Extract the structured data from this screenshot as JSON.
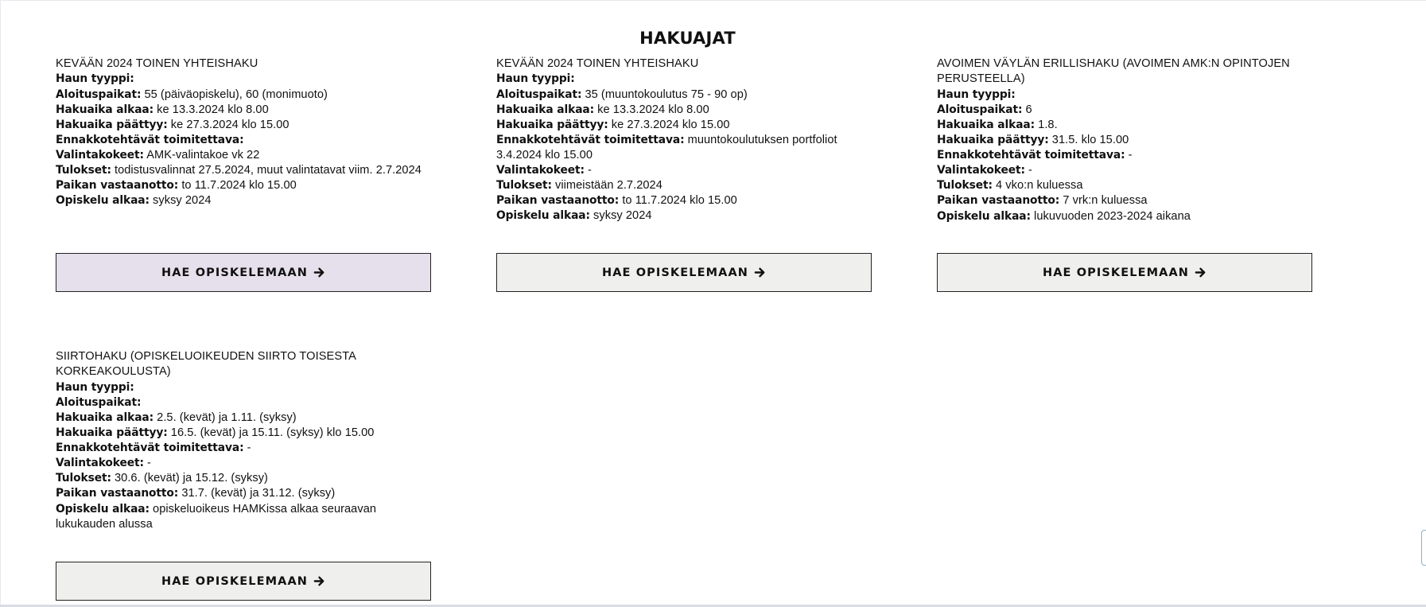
{
  "page_title": "HAKUAJAT",
  "cards": [
    {
      "title": "KEVÄÄN 2024 TOINEN YHTEISHAKU",
      "fields": {
        "tyyppi_label": "Haun tyyppi:",
        "tyyppi_value": "",
        "paikat_label": "Aloituspaikat:",
        "paikat_value": "55 (päiväopiskelu), 60 (monimuoto)",
        "alkaa_label": "Hakuaika alkaa:",
        "alkaa_value": "ke 13.3.2024 klo 8.00",
        "paattyy_label": "Hakuaika päättyy:",
        "paattyy_value": "ke 27.3.2024 klo 15.00",
        "ennakko_label": "Ennakkotehtävät toimitettava:",
        "ennakko_value": "",
        "valinta_label": "Valintakokeet:",
        "valinta_value": "AMK-valintakoe vk 22",
        "tulokset_label": "Tulokset:",
        "tulokset_value": "todistusvalinnat 27.5.2024, muut valintatavat viim. 2.7.2024",
        "vastaanotto_label": "Paikan vastaanotto:",
        "vastaanotto_value": "to 11.7.2024 klo 15.00",
        "opiskelu_label": "Opiskelu alkaa:",
        "opiskelu_value": "syksy 2024"
      },
      "button_label": "HAE OPISKELEMAAN"
    },
    {
      "title": "KEVÄÄN 2024 TOINEN YHTEISHAKU",
      "fields": {
        "tyyppi_label": "Haun tyyppi:",
        "tyyppi_value": "",
        "paikat_label": "Aloituspaikat:",
        "paikat_value": "35 (muuntokoulutus 75 - 90 op)",
        "alkaa_label": "Hakuaika alkaa:",
        "alkaa_value": "ke 13.3.2024 klo 8.00",
        "paattyy_label": "Hakuaika päättyy:",
        "paattyy_value": "ke 27.3.2024 klo 15.00",
        "ennakko_label": "Ennakkotehtävät toimitettava:",
        "ennakko_value": "muuntokoulutuksen portfoliot 3.4.2024 klo 15.00",
        "valinta_label": "Valintakokeet:",
        "valinta_value": "-",
        "tulokset_label": "Tulokset:",
        "tulokset_value": "viimeistään 2.7.2024",
        "vastaanotto_label": "Paikan vastaanotto:",
        "vastaanotto_value": "to 11.7.2024 klo 15.00",
        "opiskelu_label": "Opiskelu alkaa:",
        "opiskelu_value": "syksy 2024"
      },
      "button_label": "HAE OPISKELEMAAN"
    },
    {
      "title": "AVOIMEN VÄYLÄN ERILLISHAKU (AVOIMEN AMK:N OPINTOJEN PERUSTEELLA)",
      "fields": {
        "tyyppi_label": "Haun tyyppi:",
        "tyyppi_value": "",
        "paikat_label": "Aloituspaikat:",
        "paikat_value": "6",
        "alkaa_label": "Hakuaika alkaa:",
        "alkaa_value": "1.8.",
        "paattyy_label": "Hakuaika päättyy:",
        "paattyy_value": "31.5. klo 15.00",
        "ennakko_label": "Ennakkotehtävät toimitettava:",
        "ennakko_value": "-",
        "valinta_label": "Valintakokeet:",
        "valinta_value": "-",
        "tulokset_label": "Tulokset:",
        "tulokset_value": "4 vko:n kuluessa",
        "vastaanotto_label": "Paikan vastaanotto:",
        "vastaanotto_value": "7 vrk:n kuluessa",
        "opiskelu_label": "Opiskelu alkaa:",
        "opiskelu_value": "lukuvuoden 2023-2024 aikana"
      },
      "button_label": "HAE OPISKELEMAAN"
    },
    {
      "title": "SIIRTOHAKU (OPISKELUOIKEUDEN SIIRTO TOISESTA KORKEAKOULUSTA)",
      "fields": {
        "tyyppi_label": "Haun tyyppi:",
        "tyyppi_value": "",
        "paikat_label": "Aloituspaikat:",
        "paikat_value": "",
        "alkaa_label": "Hakuaika alkaa:",
        "alkaa_value": "2.5. (kevät) ja 1.11. (syksy)",
        "paattyy_label": "Hakuaika päättyy:",
        "paattyy_value": "16.5. (kevät) ja 15.11. (syksy) klo 15.00",
        "ennakko_label": "Ennakkotehtävät toimitettava:",
        "ennakko_value": "-",
        "valinta_label": "Valintakokeet:",
        "valinta_value": "-",
        "tulokset_label": "Tulokset:",
        "tulokset_value": "30.6. (kevät) ja 15.12. (syksy)",
        "vastaanotto_label": "Paikan vastaanotto:",
        "vastaanotto_value": "31.7. (kevät) ja 31.12. (syksy)",
        "opiskelu_label": "Opiskelu alkaa:",
        "opiskelu_value": "opiskeluoikeus HAMKissa alkaa seuraavan lukukauden alussa"
      },
      "button_label": "HAE OPISKELEMAAN"
    }
  ],
  "colors": {
    "button_bg": "#efefed",
    "button_bg_hovered": "#e6e0ec",
    "border": "#222222",
    "text": "#111111"
  },
  "icons": {
    "button_icon": "arrow-right-icon"
  }
}
